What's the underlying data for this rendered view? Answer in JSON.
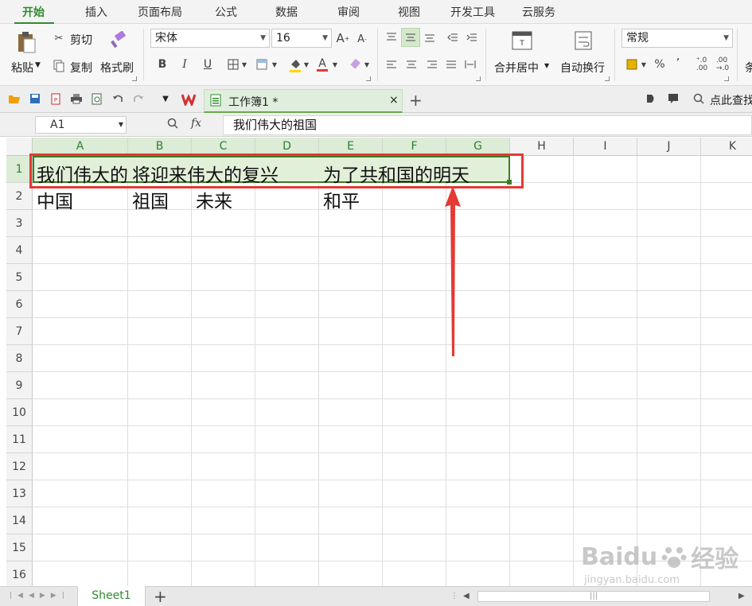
{
  "ribbon_tabs": [
    "开始",
    "插入",
    "页面布局",
    "公式",
    "数据",
    "审阅",
    "视图",
    "开发工具",
    "云服务"
  ],
  "clipboard": {
    "paste": "粘贴",
    "cut": "剪切",
    "copy": "复制",
    "format_painter": "格式刷"
  },
  "font": {
    "name": "宋体",
    "size": "16"
  },
  "alignment": {
    "merge_center": "合并居中",
    "wrap_text": "自动换行"
  },
  "number_format": {
    "value": "常规",
    "percent": "%"
  },
  "right_cut": "条",
  "document_tab": {
    "title": "工作簿1 *"
  },
  "quick_search": "点此查找",
  "name_box": "A1",
  "formula_bar": {
    "fx": "fx",
    "content": "我们伟大的祖国"
  },
  "columns": [
    "A",
    "B",
    "C",
    "D",
    "E",
    "F",
    "G",
    "H",
    "I",
    "J",
    "K"
  ],
  "rows": [
    "1",
    "2",
    "3",
    "4",
    "5",
    "6",
    "7",
    "8",
    "9",
    "10",
    "11",
    "12",
    "13",
    "14",
    "15",
    "16"
  ],
  "cells": {
    "A1": "我们伟大的祖国",
    "B1": "将迎来伟大的复兴",
    "E1": "为了共和国的明天",
    "A2": "中国",
    "B2": "祖国",
    "C2": "未来",
    "E2": "和平"
  },
  "sheet_tab": "Sheet1",
  "watermark": {
    "brand": "Baidu",
    "brand_cn": "经验",
    "url": "jingyan.baidu.com"
  },
  "colors": {
    "accent": "#2e8b2e",
    "selection": "#e2f0d9",
    "annotation": "#e53935"
  }
}
